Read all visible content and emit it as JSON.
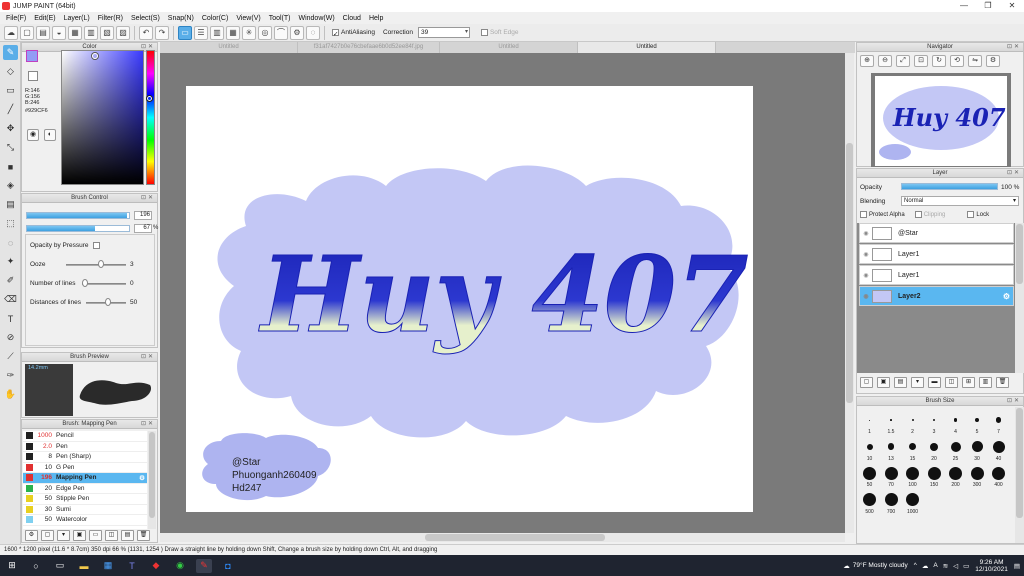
{
  "window": {
    "title": "JUMP PAINT (64bit)",
    "min": "—",
    "max": "❐",
    "close": "✕"
  },
  "menu": [
    "File(F)",
    "Edit(E)",
    "Layer(L)",
    "Filter(R)",
    "Select(S)",
    "Snap(N)",
    "Color(C)",
    "View(V)",
    "Tool(T)",
    "Window(W)",
    "Cloud",
    "Help"
  ],
  "toolbar": {
    "antialiasing_label": "AntiAliasing",
    "correction_label": "Correction",
    "correction_value": "39",
    "soft_edge_label": "Soft Edge"
  },
  "color_panel": {
    "title": "Color",
    "fg_color": "#929CF6",
    "rgb": [
      "R:146",
      "G:156",
      "B:246"
    ],
    "hex_label": "#929CF6"
  },
  "brush_control": {
    "title": "Brush Control",
    "size_value": "196",
    "size_fill": 0.98,
    "opacity_value": "67",
    "opacity_unit": "%",
    "opacity_fill": 0.67,
    "opacity_by_pressure": "Opacity by Pressure",
    "ooze_label": "Ooze",
    "ooze_value": "3",
    "lines_label": "Number of lines",
    "lines_value": "0",
    "distance_label": "Distances of lines",
    "distance_value": "50"
  },
  "brush_preview": {
    "title": "Brush Preview",
    "size_label": "14.2mm"
  },
  "brush_list": {
    "title": "Brush: Mapping Pen",
    "items": [
      {
        "size": "1000",
        "name": "Pencil",
        "color": "#222222",
        "size_color": "#e03030"
      },
      {
        "size": "2.0",
        "name": "Pen",
        "color": "#222222",
        "size_color": "#e03030"
      },
      {
        "size": "8",
        "name": "Pen (Sharp)",
        "color": "#222222",
        "size_color": "#222222"
      },
      {
        "size": "10",
        "name": "G Pen",
        "color": "#e03030",
        "size_color": "#222222"
      },
      {
        "size": "196",
        "name": "Mapping Pen",
        "color": "#e03030",
        "size_color": "#e03030",
        "selected": true
      },
      {
        "size": "20",
        "name": "Edge Pen",
        "color": "#2bb24c",
        "size_color": "#222222"
      },
      {
        "size": "50",
        "name": "Stipple Pen",
        "color": "#e8d020",
        "size_color": "#222222"
      },
      {
        "size": "30",
        "name": "Sumi",
        "color": "#e8d020",
        "size_color": "#222222"
      },
      {
        "size": "50",
        "name": "Watercolor",
        "color": "#7fd0f0",
        "size_color": "#222222"
      }
    ]
  },
  "tabs": [
    {
      "label": "Untitled",
      "active": false
    },
    {
      "label": "f31af7427b0e76cbefaae6b0d52ee84f.jpg",
      "active": false
    },
    {
      "label": "Untitled",
      "active": false
    },
    {
      "label": "Untitled",
      "active": true
    }
  ],
  "artwork": {
    "title": "Huy 407",
    "credit_lines": [
      "@Star",
      "Phuonganh260409",
      "Hd247"
    ],
    "cloud_color": "#c3c7f5",
    "text_color": "#1a22b4"
  },
  "navigator": {
    "title": "Navigator",
    "thumb_title": "Huy 407"
  },
  "layer_panel": {
    "title": "Layer",
    "opacity_label": "Opacity",
    "opacity_value": "100 %",
    "blending_label": "Blending",
    "blending_value": "Normal",
    "protect_alpha": "Protect Alpha",
    "clipping": "Clipping",
    "lock": "Lock",
    "layers": [
      {
        "name": "@Star",
        "selected": false
      },
      {
        "name": "Layer1",
        "selected": false
      },
      {
        "name": "Layer1",
        "selected": false
      },
      {
        "name": "Layer2",
        "selected": true
      }
    ]
  },
  "brush_size": {
    "title": "Brush Size",
    "sizes": [
      "1",
      "1.5",
      "2",
      "3",
      "4",
      "5",
      "7",
      "10",
      "13",
      "15",
      "20",
      "25",
      "30",
      "40",
      "50",
      "70",
      "100",
      "150",
      "200",
      "300",
      "400",
      "500",
      "700",
      "1000"
    ]
  },
  "status": {
    "text": "1600 * 1200 pixel  (11.6 * 8.7cm)  350 dpi  66 %  (1131, 1254 )  Draw a straight line by holding down Shift, Change a brush size by holding down Ctrl, Alt, and dragging"
  },
  "taskbar": {
    "weather": "79°F  Mostly cloudy",
    "time": "9:26 AM",
    "date": "12/10/2021"
  }
}
